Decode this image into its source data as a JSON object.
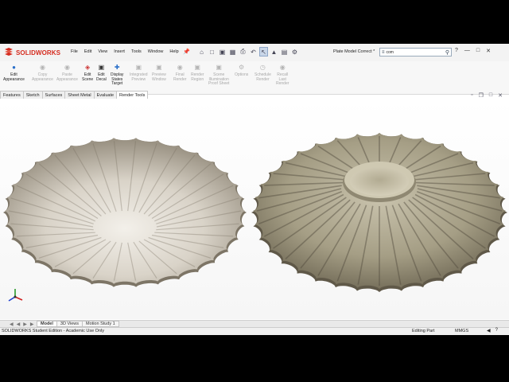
{
  "app": {
    "brand_prefix": "3S",
    "brand": "SOLIDWORKS",
    "brand_color": "#d52b1e"
  },
  "menu": [
    "File",
    "Edit",
    "View",
    "Insert",
    "Tools",
    "Window",
    "Help"
  ],
  "document_name": "Plate Model Correct *",
  "search": {
    "value": "com"
  },
  "ribbon": [
    {
      "label1": "Edit",
      "label2": "Appearance",
      "enabled": true,
      "icon": "appearance-icon"
    },
    {
      "label1": "Copy",
      "label2": "Appearance",
      "enabled": false,
      "icon": "copy-appearance-icon"
    },
    {
      "label1": "Paste",
      "label2": "Appearance",
      "enabled": false,
      "icon": "paste-appearance-icon"
    },
    {
      "label1": "Edit",
      "label2": "Scene",
      "enabled": true,
      "icon": "scene-icon"
    },
    {
      "label1": "Edit",
      "label2": "Decal",
      "enabled": true,
      "icon": "decal-icon"
    },
    {
      "label1": "Display",
      "label2": "States",
      "label3": "Target",
      "enabled": true,
      "icon": "display-states-icon"
    },
    {
      "label1": "Integrated",
      "label2": "Preview",
      "enabled": false,
      "icon": "integrated-preview-icon"
    },
    {
      "label1": "Preview",
      "label2": "Window",
      "enabled": false,
      "icon": "preview-window-icon"
    },
    {
      "label1": "Final",
      "label2": "Render",
      "enabled": false,
      "icon": "final-render-icon"
    },
    {
      "label1": "Render",
      "label2": "Region",
      "enabled": false,
      "icon": "render-region-icon"
    },
    {
      "label1": "Scene",
      "label2": "Illumination",
      "label3": "Proof Sheet",
      "enabled": false,
      "icon": "illumination-icon"
    },
    {
      "label1": "Options",
      "label2": "",
      "enabled": false,
      "icon": "options-icon"
    },
    {
      "label1": "Schedule",
      "label2": "Render",
      "enabled": false,
      "icon": "schedule-render-icon"
    },
    {
      "label1": "Recall",
      "label2": "Last",
      "label3": "Render",
      "enabled": false,
      "icon": "recall-render-icon"
    }
  ],
  "command_tabs": [
    "Features",
    "Sketch",
    "Surfaces",
    "Sheet Metal",
    "Evaluate",
    "Render Tools"
  ],
  "active_command_tab": "Render Tools",
  "bottom_tabs": [
    "Model",
    "3D Views",
    "Motion Study 1"
  ],
  "active_bottom_tab": "Model",
  "status": {
    "edition": "SOLIDWORKS Student Edition - Academic Use Only",
    "mode": "Editing Part",
    "units": "MMGS"
  },
  "colors": {
    "plate_light": "#e6e2dc",
    "plate_dark": "#8a8270",
    "plate_back": "#a39c83"
  }
}
